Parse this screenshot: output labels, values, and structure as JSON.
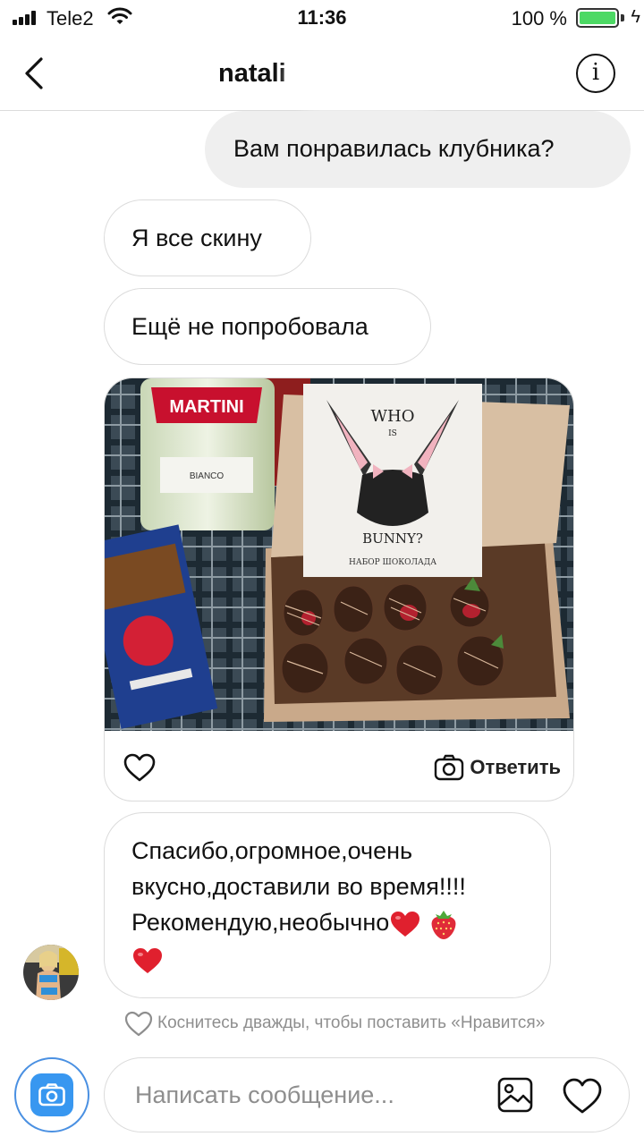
{
  "status_bar": {
    "carrier": "Tele2",
    "time": "11:36",
    "battery": "100 %",
    "battery_level": 1.0
  },
  "header": {
    "username": "natali"
  },
  "messages": [
    {
      "direction": "outgoing",
      "text": "Вам понравилась клубника?"
    },
    {
      "direction": "incoming",
      "text": "Я все скину"
    },
    {
      "direction": "incoming",
      "text": "Ещё не попробовала"
    },
    {
      "direction": "incoming",
      "type": "photo",
      "photo_text": {
        "bottle_brand": "MARTINI",
        "bottle_variant": "BIANCO",
        "card_who": "WHO",
        "card_is": "IS",
        "card_bunny": "BUNNY?",
        "card_caption": "НАБОР ШОКОЛАДА"
      },
      "reply_label": "Ответить"
    },
    {
      "direction": "incoming",
      "lines": [
        "Спасибо,огромное,очень",
        "вкусно,доставили во время!!!!",
        "Рекомендую,необычно"
      ]
    }
  ],
  "hint": "Коснитесь дважды, чтобы поставить «Нравится»",
  "composer": {
    "placeholder": "Написать сообщение..."
  },
  "colors": {
    "outgoing_bubble": "#efefef",
    "border": "#dbdbdb",
    "camera_button": "#3897f0",
    "heart_emoji": "#e0202e"
  },
  "icons": [
    "back-arrow-icon",
    "info-icon",
    "heart-icon",
    "camera-icon",
    "gallery-icon",
    "wifi-icon",
    "battery-icon"
  ]
}
